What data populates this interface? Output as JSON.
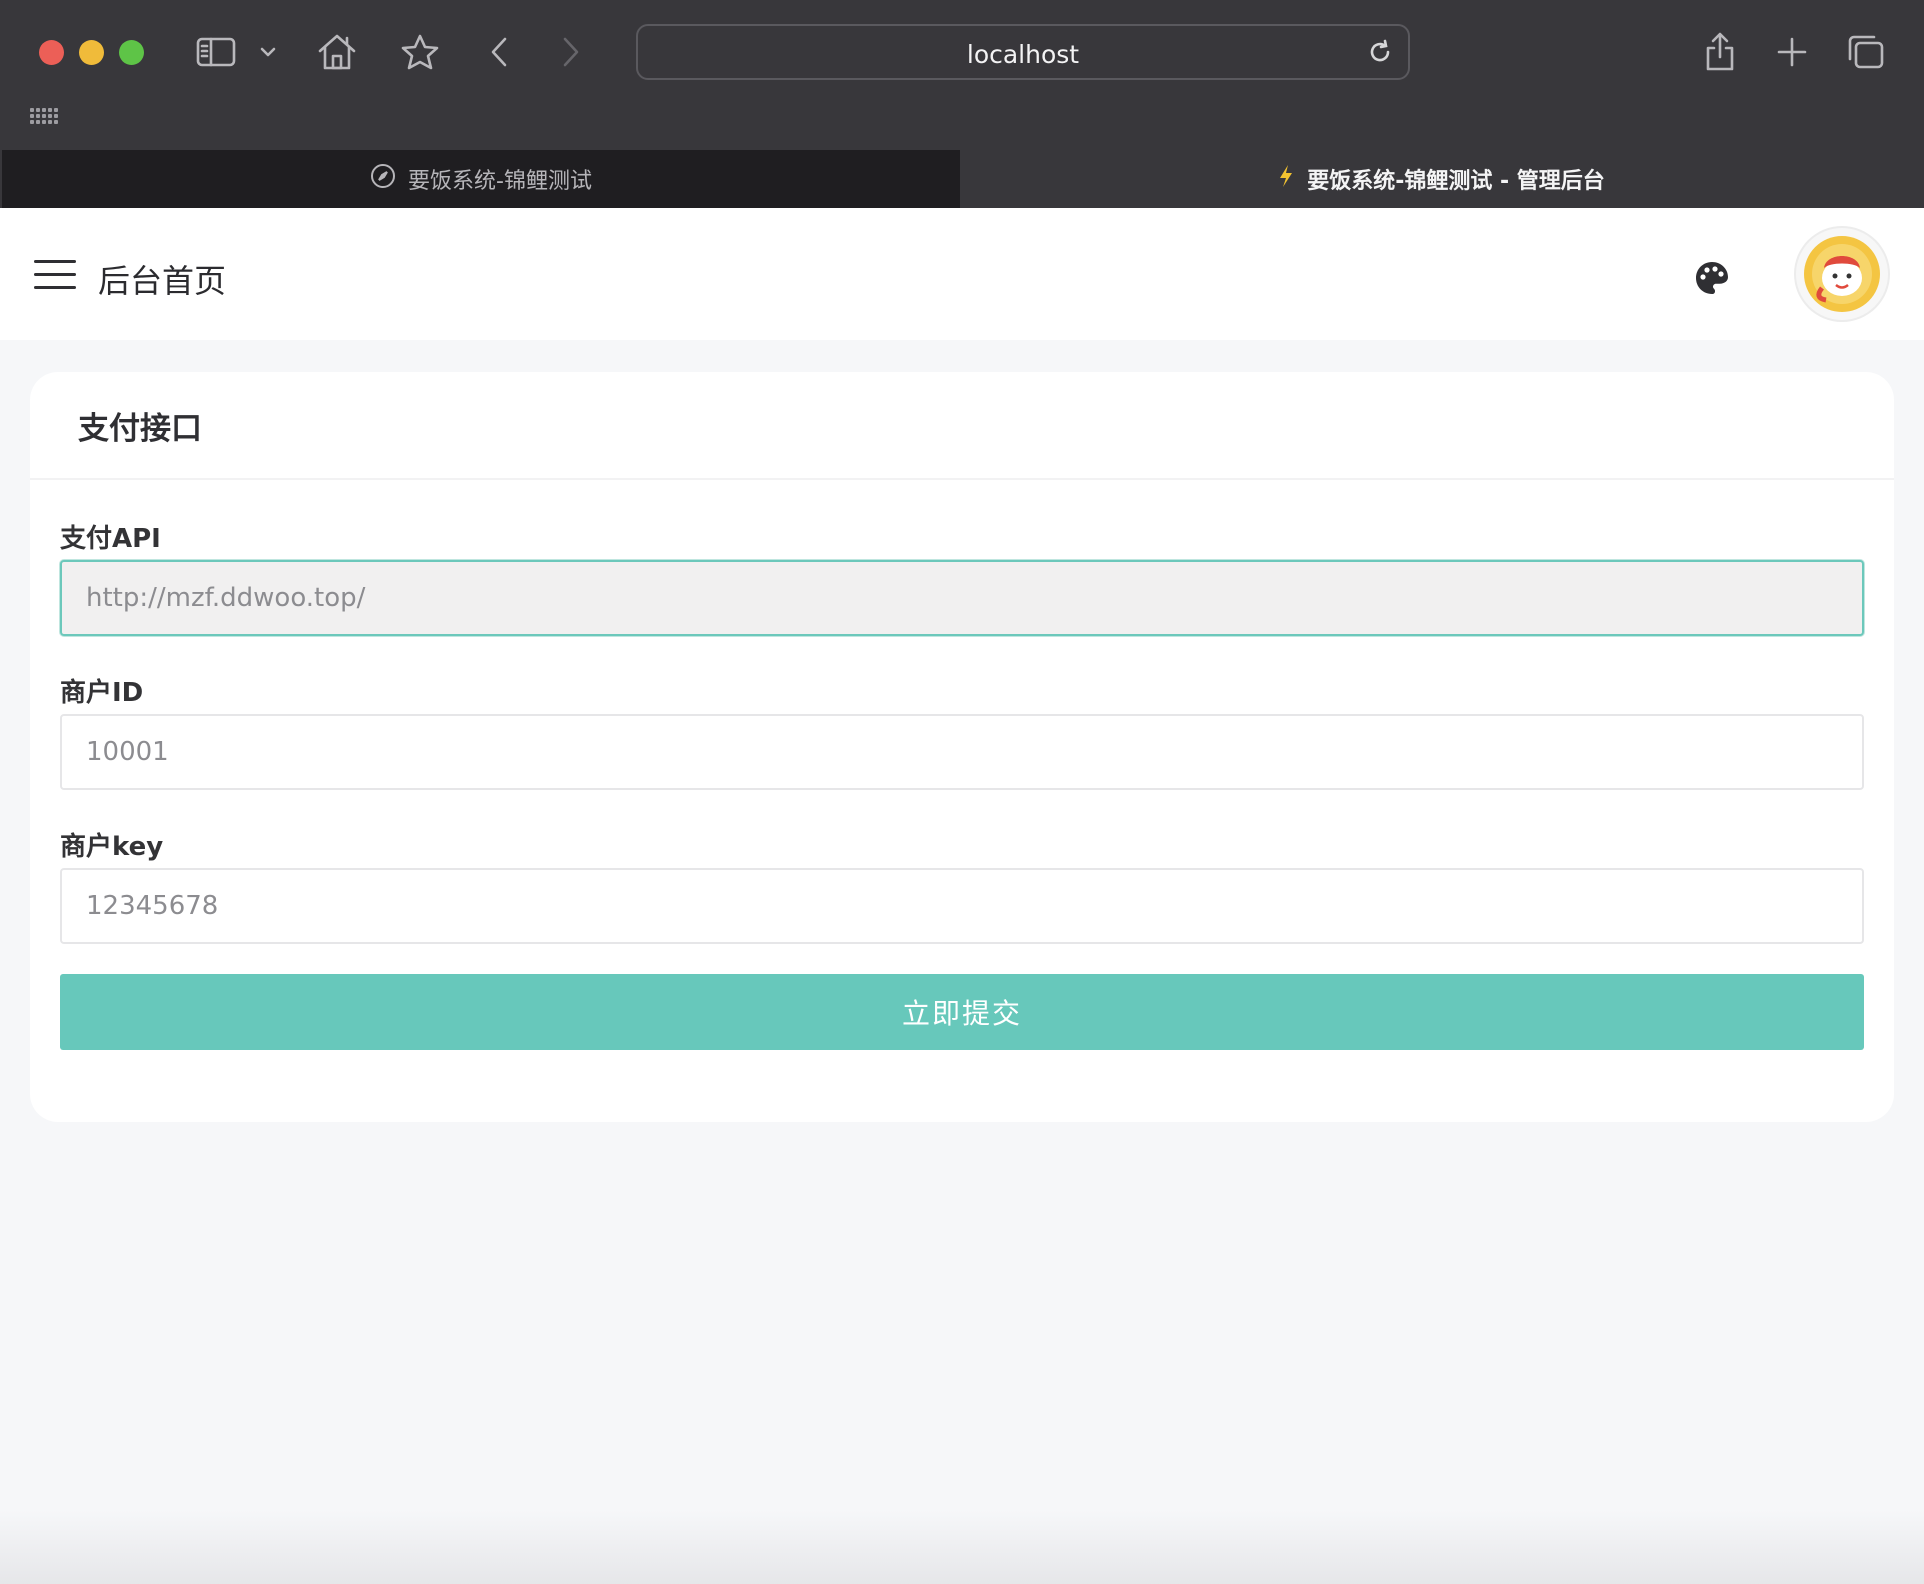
{
  "browser": {
    "url": "localhost",
    "tabs": [
      {
        "title": "要饭系统-锦鲤测试",
        "active": false,
        "icon": "compass-icon"
      },
      {
        "title": "要饭系统-锦鲤测试 - 管理后台",
        "active": true,
        "icon": "lightning-icon"
      }
    ]
  },
  "header": {
    "title": "后台首页"
  },
  "card": {
    "title": "支付接口",
    "fields": [
      {
        "label": "支付API",
        "value": "http://mzf.ddwoo.top/"
      },
      {
        "label": "商户ID",
        "value": "10001"
      },
      {
        "label": "商户key",
        "value": "12345678"
      }
    ],
    "submit_label": "立即提交"
  },
  "colors": {
    "accent": "#67c8bb",
    "chrome": "#38373b"
  }
}
